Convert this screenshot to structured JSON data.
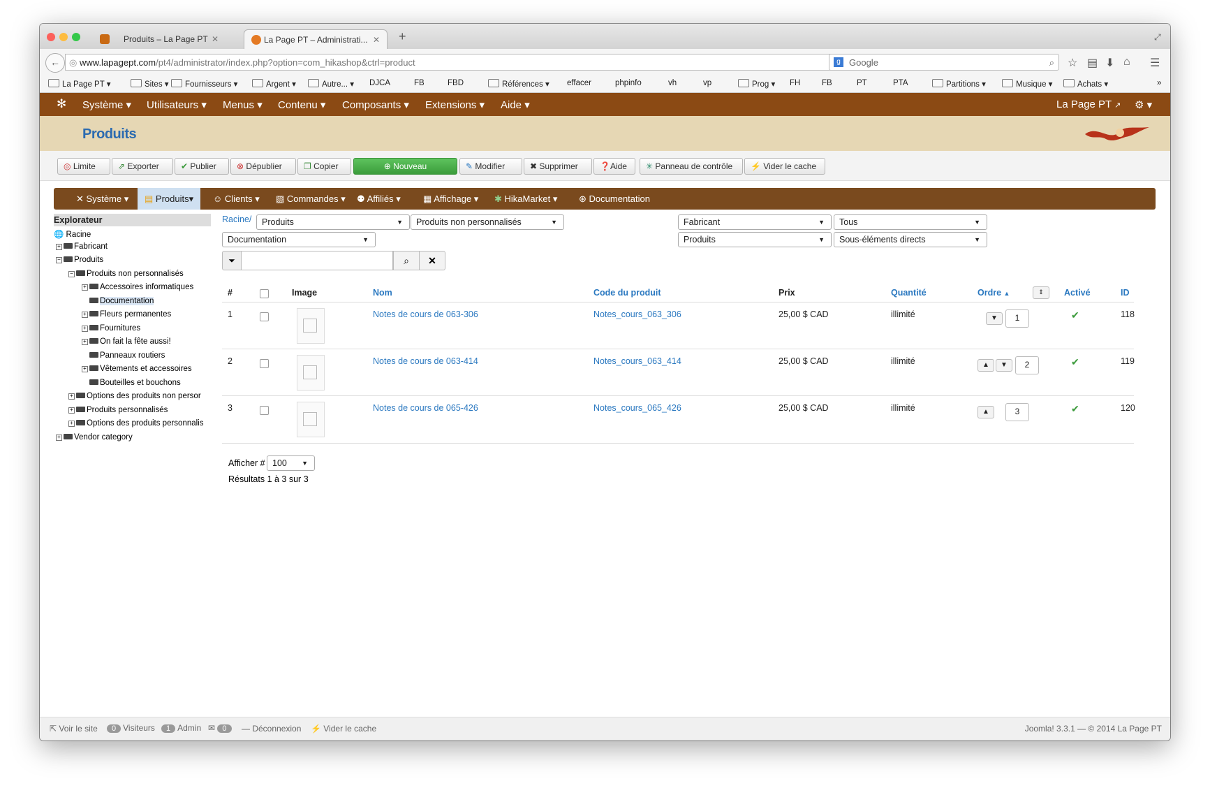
{
  "browser": {
    "tabs": [
      {
        "label": "Produits – La Page PT"
      },
      {
        "label": "La Page PT – Administrati..."
      }
    ],
    "url_domain": "www.lapagept.com",
    "url_path": "/pt4/administrator/index.php?option=com_hikashop&ctrl=product",
    "search_placeholder": "Google",
    "bookmarks": [
      "La Page PT",
      "Sites",
      "Fournisseurs",
      "Argent",
      "Autre...",
      "DJCA",
      "FB",
      "FBD",
      "Références",
      "effacer",
      "phpinfo",
      "vh",
      "vp",
      "Prog",
      "FH",
      "FB",
      "PT",
      "PTA",
      "Partitions",
      "Musique",
      "Achats"
    ]
  },
  "joomla": {
    "menu": [
      "Système",
      "Utilisateurs",
      "Menus",
      "Contenu",
      "Composants",
      "Extensions",
      "Aide"
    ],
    "site_link": "La Page PT",
    "page_title": "Produits"
  },
  "toolbar": {
    "limit": "Limite",
    "export": "Exporter",
    "publish": "Publier",
    "unpublish": "Dépublier",
    "copy": "Copier",
    "new": "Nouveau",
    "edit": "Modifier",
    "delete": "Supprimer",
    "help": "Aide",
    "control_panel": "Panneau de contrôle",
    "clear_cache": "Vider le cache"
  },
  "hika_menu": [
    "Système",
    "Produits",
    "Clients",
    "Commandes",
    "Affiliés",
    "Affichage",
    "HikaMarket",
    "Documentation"
  ],
  "explorer": {
    "title": "Explorateur",
    "root": "Racine",
    "nodes": [
      {
        "label": "Fabricant"
      },
      {
        "label": "Produits"
      },
      {
        "label": "Produits non personnalisés"
      },
      {
        "label": "Accessoires informatiques"
      },
      {
        "label": "Documentation"
      },
      {
        "label": "Fleurs permanentes"
      },
      {
        "label": "Fournitures"
      },
      {
        "label": "On fait la fête aussi!"
      },
      {
        "label": "Panneaux routiers"
      },
      {
        "label": "Vêtements et accessoires"
      },
      {
        "label": "Bouteilles et bouchons"
      },
      {
        "label": "Options des produits non persor"
      },
      {
        "label": "Produits personnalisés"
      },
      {
        "label": "Options des produits personnalis"
      },
      {
        "label": "Vendor category"
      }
    ]
  },
  "filters": {
    "breadcrumb": "Racine/",
    "cat1": "Produits",
    "cat2": "Produits non personnalisés",
    "cat3": "Documentation",
    "right1": "Fabricant",
    "right2": "Tous",
    "right3": "Produits",
    "right4": "Sous-éléments directs",
    "search_value": ""
  },
  "table": {
    "headers": {
      "num": "#",
      "image": "Image",
      "name": "Nom",
      "code": "Code du produit",
      "price": "Prix",
      "qty": "Quantité",
      "order": "Ordre",
      "active": "Activé",
      "id": "ID"
    },
    "rows": [
      {
        "num": "1",
        "name": "Notes de cours de 063-306",
        "code": "Notes_cours_063_306",
        "price": "25,00 $ CAD",
        "qty": "illimité",
        "order": "1",
        "id": "118"
      },
      {
        "num": "2",
        "name": "Notes de cours de 063-414",
        "code": "Notes_cours_063_414",
        "price": "25,00 $ CAD",
        "qty": "illimité",
        "order": "2",
        "id": "119"
      },
      {
        "num": "3",
        "name": "Notes de cours de 065-426",
        "code": "Notes_cours_065_426",
        "price": "25,00 $ CAD",
        "qty": "illimité",
        "order": "3",
        "id": "120"
      }
    ]
  },
  "pagination": {
    "label": "Afficher #",
    "value": "100",
    "results": "Résultats 1 à 3 sur 3"
  },
  "footer": {
    "view_site": "Voir le site",
    "visitors_count": "0",
    "visitors": "Visiteurs",
    "admin_count": "1",
    "admin": "Admin",
    "msg_count": "0",
    "logout": "Déconnexion",
    "clear_cache": "Vider le cache",
    "version": "Joomla! 3.3.1 — © 2014 La Page PT"
  },
  "colors": {
    "joomla_bar": "#8b4a14",
    "header_bg": "#e6d7b4",
    "link": "#2a78c0",
    "new_btn": "#3b9c3b"
  }
}
